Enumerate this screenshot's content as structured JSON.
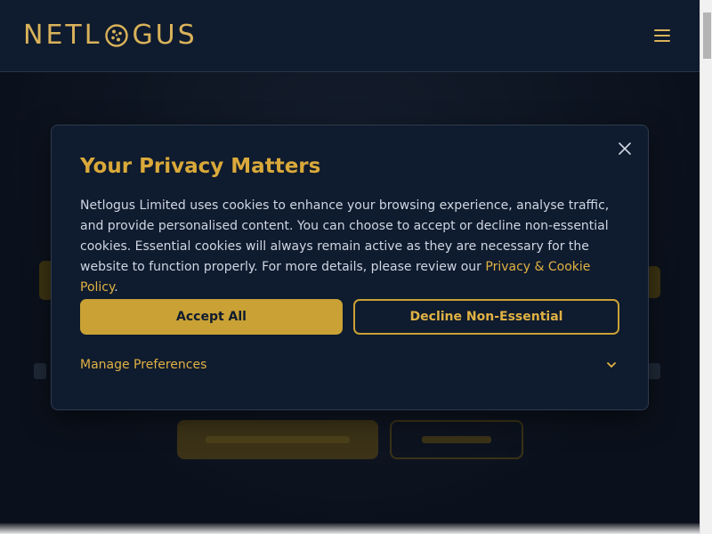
{
  "header": {
    "logo_text_before": "NETL",
    "logo_text_after": "GUS",
    "menu_icon": "hamburger-menu-icon"
  },
  "cookie_modal": {
    "title": "Your Privacy Matters",
    "body_text": "Netlogus Limited uses cookies to enhance your browsing experience, analyse traffic, and provide personalised content. You can choose to accept or decline non-essential cookies. Essential cookies will always remain active as they are necessary for the website to function properly. For more details, please review our ",
    "policy_link_text": "Privacy & Cookie Policy",
    "body_text_end": ".",
    "accept_label": "Accept All",
    "decline_label": "Decline Non-Essential",
    "manage_label": "Manage Preferences",
    "close_icon": "close-icon",
    "chevron_icon": "chevron-down-icon"
  },
  "colors": {
    "brand_gold": "#d9b25a",
    "button_gold": "#c9a135",
    "navy_background": "#0f1b2e",
    "body_text": "#cfd6e3"
  }
}
